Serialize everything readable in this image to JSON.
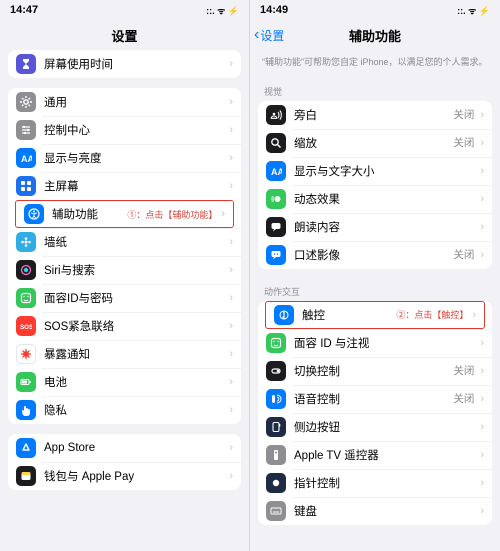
{
  "left": {
    "time": "14:47",
    "signal": "▪▪▪▪",
    "wifi": "􀙇",
    "battery": "􀛨",
    "title": "设置",
    "groups": [
      [
        {
          "icon": "hourglass",
          "bg": "c-purple",
          "label": "屏幕使用时间"
        }
      ],
      [
        {
          "icon": "gear",
          "bg": "c-grey",
          "label": "通用"
        },
        {
          "icon": "sliders",
          "bg": "c-grey",
          "label": "控制中心"
        },
        {
          "icon": "textsize",
          "bg": "c-blue",
          "label": "显示与亮度"
        },
        {
          "icon": "grid",
          "bg": "c-blue2",
          "label": "主屏幕"
        },
        {
          "icon": "accessibility",
          "bg": "c-blue",
          "label": "辅助功能",
          "annot": "①：点击【辅助功能】",
          "hl": true
        },
        {
          "icon": "flower",
          "bg": "c-cyan",
          "label": "墙纸"
        },
        {
          "icon": "siri",
          "bg": "c-black",
          "label": "Siri与搜索"
        },
        {
          "icon": "faceid",
          "bg": "c-green",
          "label": "面容ID与密码"
        },
        {
          "icon": "sos",
          "bg": "c-red",
          "label": "SOS紧急联络"
        },
        {
          "icon": "virus",
          "bg": "c-white",
          "label": "暴露通知"
        },
        {
          "icon": "battery",
          "bg": "c-green",
          "label": "电池"
        },
        {
          "icon": "hand",
          "bg": "c-blue",
          "label": "隐私"
        }
      ],
      [
        {
          "icon": "appstore",
          "bg": "c-blue",
          "label": "App Store"
        },
        {
          "icon": "wallet",
          "bg": "c-black",
          "label": "钱包与 Apple Pay"
        }
      ]
    ]
  },
  "right": {
    "time": "14:49",
    "back": "设置",
    "title": "辅助功能",
    "helper": "“辅助功能”可帮助您自定 iPhone，以满足您的个人需求。",
    "sections": [
      {
        "label": "视觉",
        "rows": [
          {
            "icon": "voiceover",
            "bg": "c-black",
            "label": "旁白",
            "value": "关闭"
          },
          {
            "icon": "zoom",
            "bg": "c-black",
            "label": "缩放",
            "value": "关闭"
          },
          {
            "icon": "textsize",
            "bg": "c-blue",
            "label": "显示与文字大小"
          },
          {
            "icon": "motion",
            "bg": "c-green",
            "label": "动态效果"
          },
          {
            "icon": "speech",
            "bg": "c-black",
            "label": "朗读内容"
          },
          {
            "icon": "audiodesc",
            "bg": "c-blue",
            "label": "口述影像",
            "value": "关闭"
          }
        ]
      },
      {
        "label": "动作交互",
        "rows": [
          {
            "icon": "touch",
            "bg": "c-blue",
            "label": "触控",
            "annot": "②：点击【触控】",
            "hl": true
          },
          {
            "icon": "faceid",
            "bg": "c-green",
            "label": "面容 ID 与注视"
          },
          {
            "icon": "switch",
            "bg": "c-black",
            "label": "切换控制",
            "value": "关闭"
          },
          {
            "icon": "voice",
            "bg": "c-blue",
            "label": "语音控制",
            "value": "关闭"
          },
          {
            "icon": "sidebtn",
            "bg": "c-dkblue",
            "label": "侧边按钮"
          },
          {
            "icon": "remote",
            "bg": "c-grey",
            "label": "Apple TV 遥控器"
          },
          {
            "icon": "pointer",
            "bg": "c-dkblue",
            "label": "指针控制"
          },
          {
            "icon": "keyboard",
            "bg": "c-grey",
            "label": "键盘"
          }
        ]
      }
    ]
  },
  "status_icons": "::. ᯤ ⚡"
}
